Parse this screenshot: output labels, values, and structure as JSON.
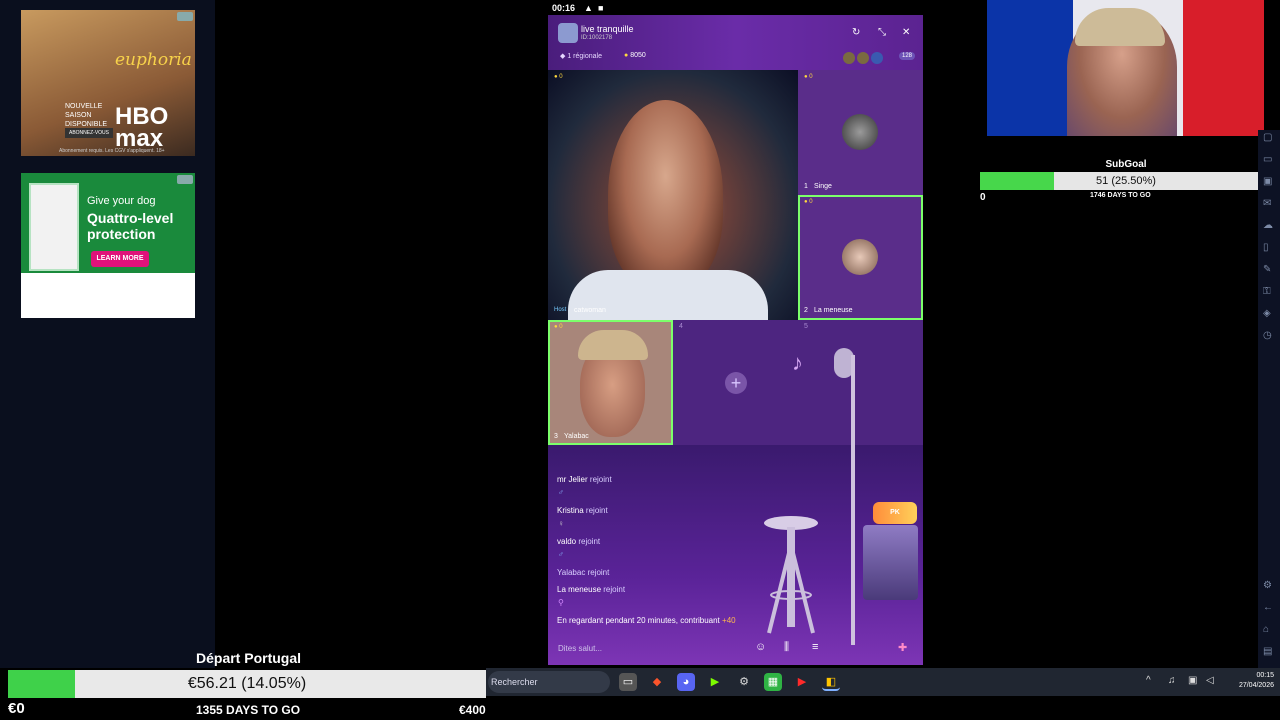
{
  "ads": {
    "ad1": {
      "brand": "euphoria",
      "network": "HBO max",
      "cta_text": "NOUVELLE SAISON DISPONIBLE",
      "cta_button": "ABONNEZ-VOUS",
      "fine_print": "Abonnement requis. Les CGV s'appliquent. 18+"
    },
    "ad2": {
      "headline_small": "Give your dog",
      "headline_big": "Quattro-level protection",
      "button": "LEARN MORE"
    }
  },
  "phone": {
    "status_time": "00:16",
    "room": {
      "title": "live tranquille",
      "id": "ID:1002178",
      "region": "1 régionale",
      "coins": "8050",
      "audience_count": "128"
    },
    "seats": [
      {
        "num": "",
        "name": "catwoman",
        "role": "Host",
        "coins": "0"
      },
      {
        "num": "1",
        "name": "Singe",
        "coins": "0"
      },
      {
        "num": "2",
        "name": "La meneuse",
        "coins": "0"
      },
      {
        "num": "3",
        "name": "Yalabac",
        "coins": "0"
      },
      {
        "num": "4"
      },
      {
        "num": "5"
      }
    ],
    "chat": [
      {
        "user": "mr Jelier",
        "action": "rejoint"
      },
      {
        "user": "Kristina",
        "action": "rejoint"
      },
      {
        "user": "valdo",
        "action": "rejoint"
      },
      {
        "user": "Yalabac",
        "action": "rejoint"
      },
      {
        "user": "La meneuse",
        "action": "rejoint"
      },
      {
        "text": "En regardant pendant 20 minutes, contribuant",
        "bonus": "+40"
      }
    ],
    "input_placeholder": "Dites salut...",
    "pk_badge": "PK"
  },
  "subgoal": {
    "title": "SubGoal",
    "value": "51 (25.50%)",
    "progress": 0.255,
    "start": "0",
    "days": "1746 DAYS TO GO"
  },
  "goal": {
    "title": "Départ Portugal",
    "value": "€56.21 (14.05%)",
    "progress": 0.1405,
    "start": "€0",
    "days": "1355 DAYS TO GO",
    "end": "€400"
  },
  "taskbar": {
    "search_placeholder": "Rechercher",
    "time": "00:15",
    "date": "27/04/2026"
  },
  "colors": {
    "progress_green": "#47d74b",
    "seat_border": "#7cff6b",
    "room_purple": "#5b2391"
  }
}
